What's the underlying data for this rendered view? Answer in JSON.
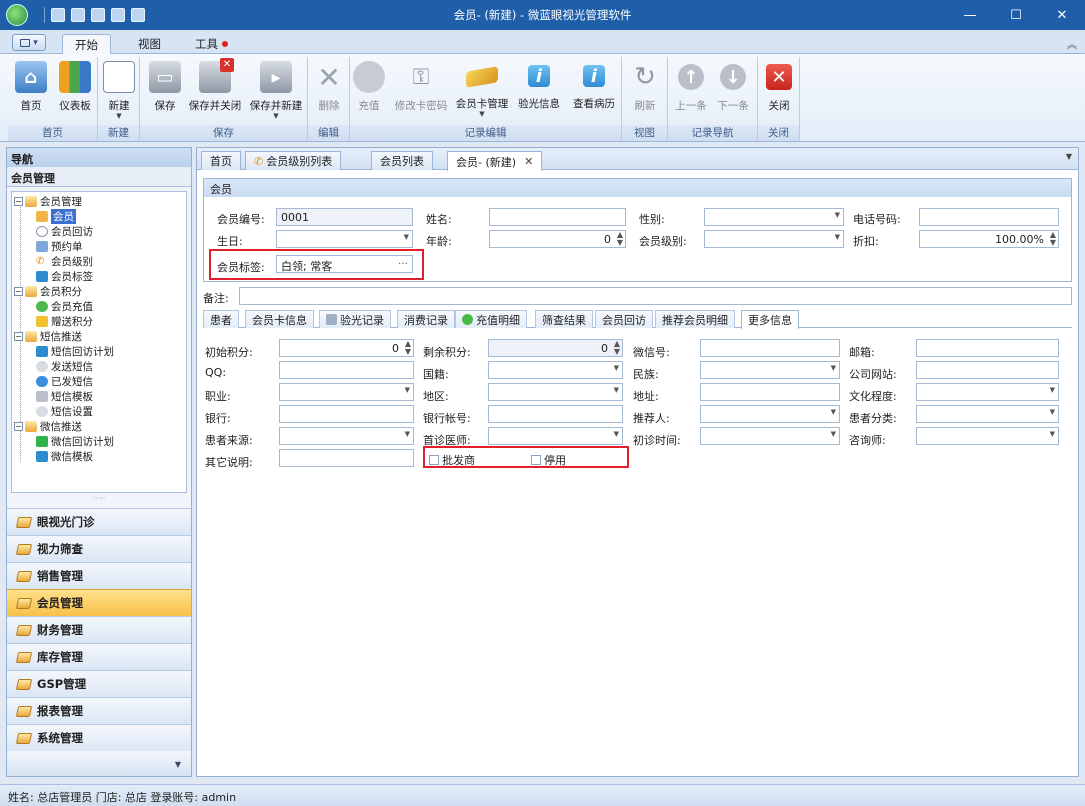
{
  "window": {
    "title": "会员- (新建) - 微蓝眼视光管理软件",
    "min": "—",
    "max": "☐",
    "close": "✕"
  },
  "ribbon_tabs": [
    {
      "label": "开始"
    },
    {
      "label": "视图"
    },
    {
      "label": "工具"
    }
  ],
  "ribbon": {
    "buttons": {
      "home": "首页",
      "dashboard": "仪表板",
      "new": "新建",
      "save": "保存",
      "save_close": "保存并关闭",
      "save_new": "保存并新建",
      "delete": "删除",
      "recharge": "充值",
      "change_pwd": "修改卡密码",
      "card_mgmt": "会员卡管理",
      "optometry": "验光信息",
      "history": "查看病历",
      "refresh": "刷新",
      "prev": "上一条",
      "next": "下一条",
      "close": "关闭"
    },
    "groups": {
      "home": "首页",
      "new": "新建",
      "save": "保存",
      "edit": "编辑",
      "record_edit": "记录编辑",
      "view": "视图",
      "record_nav": "记录导航",
      "close": "关闭"
    }
  },
  "nav": {
    "header": "导航",
    "section": "会员管理",
    "tree": [
      {
        "label": "会员管理"
      },
      {
        "label": "会员"
      },
      {
        "label": "会员回访"
      },
      {
        "label": "预约单"
      },
      {
        "label": "会员级别"
      },
      {
        "label": "会员标签"
      },
      {
        "label": "会员积分"
      },
      {
        "label": "会员充值"
      },
      {
        "label": "赠送积分"
      },
      {
        "label": "短信推送"
      },
      {
        "label": "短信回访计划"
      },
      {
        "label": "发送短信"
      },
      {
        "label": "已发短信"
      },
      {
        "label": "短信模板"
      },
      {
        "label": "短信设置"
      },
      {
        "label": "微信推送"
      },
      {
        "label": "微信回访计划"
      },
      {
        "label": "微信模板"
      }
    ],
    "modules": [
      {
        "label": "眼视光门诊"
      },
      {
        "label": "视力筛查"
      },
      {
        "label": "销售管理"
      },
      {
        "label": "会员管理"
      },
      {
        "label": "财务管理"
      },
      {
        "label": "库存管理"
      },
      {
        "label": "GSP管理"
      },
      {
        "label": "报表管理"
      },
      {
        "label": "系统管理"
      }
    ]
  },
  "doc_tabs": [
    {
      "label": "首页"
    },
    {
      "label": "会员级别列表"
    },
    {
      "label": "会员列表"
    },
    {
      "label": "会员- (新建)"
    }
  ],
  "member": {
    "panel_title": "会员",
    "labels": {
      "id": "会员编号:",
      "name": "姓名:",
      "gender": "性别:",
      "phone": "电话号码:",
      "birthday": "生日:",
      "age": "年龄:",
      "level": "会员级别:",
      "discount": "折扣:",
      "tags": "会员标签:",
      "remark": "备注:"
    },
    "values": {
      "id": "0001",
      "name": "",
      "gender": "",
      "phone": "",
      "birthday": "",
      "age": "0",
      "level": "",
      "discount": "100.00%",
      "tags": "白领; 常客",
      "remark": ""
    }
  },
  "sub_tabs": [
    {
      "label": "患者"
    },
    {
      "label": "会员卡信息"
    },
    {
      "label": "验光记录"
    },
    {
      "label": "消费记录"
    },
    {
      "label": "充值明细"
    },
    {
      "label": "筛查结果"
    },
    {
      "label": "会员回访"
    },
    {
      "label": "推荐会员明细"
    },
    {
      "label": "更多信息"
    }
  ],
  "more": {
    "labels": {
      "init_points": "初始积分:",
      "remain_points": "剩余积分:",
      "wechat": "微信号:",
      "email": "邮箱:",
      "qq": "QQ:",
      "nationality": "国籍:",
      "ethnicity": "民族:",
      "website": "公司网站:",
      "job": "职业:",
      "area": "地区:",
      "address": "地址:",
      "education": "文化程度:",
      "bank": "银行:",
      "bank_account": "银行帐号:",
      "referrer": "推荐人:",
      "patient_class": "患者分类:",
      "source": "患者来源:",
      "doctor": "首诊医师:",
      "first_visit": "初诊时间:",
      "consultant": "咨询师:",
      "other": "其它说明:"
    },
    "values": {
      "init_points": "0",
      "remain_points": "0"
    },
    "checkboxes": {
      "wholesaler": "批发商",
      "disabled": "停用"
    }
  },
  "status": {
    "text": "姓名: 总店管理员 门店: 总店 登录账号: admin"
  }
}
